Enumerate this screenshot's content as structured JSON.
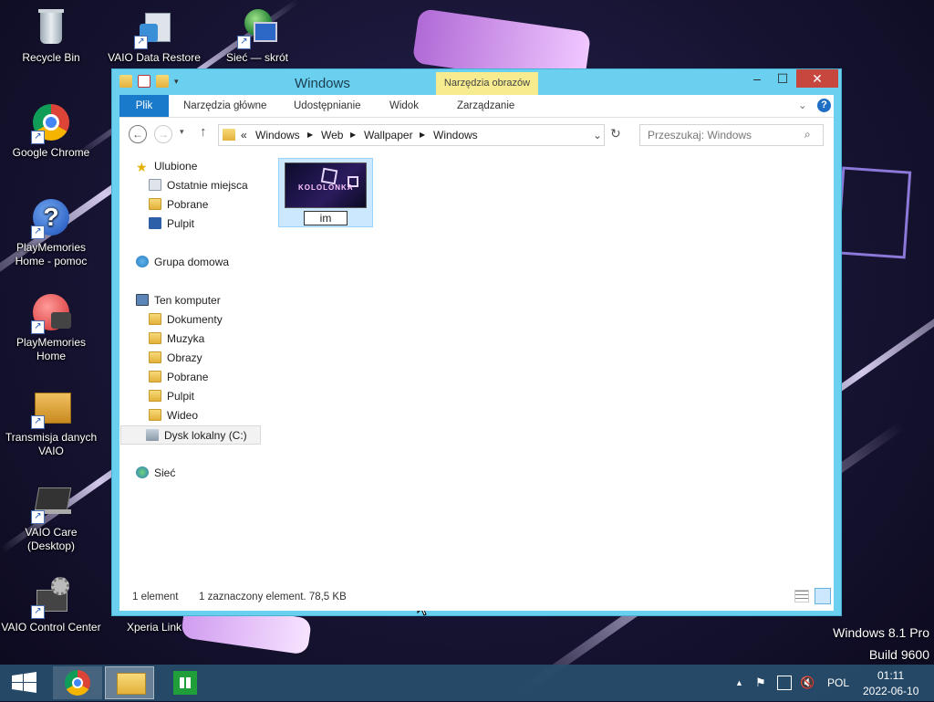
{
  "desktop": {
    "icons": [
      {
        "label": "Recycle Bin",
        "icon": "recycle-bin-icon"
      },
      {
        "label": "VAIO Data Restore",
        "icon": "vaio-data-restore-icon"
      },
      {
        "label": "Sieć — skrót",
        "icon": "network-shortcut-icon"
      },
      {
        "label": "Google Chrome",
        "icon": "chrome-icon"
      },
      {
        "label": "PlayMemories Home - pomoc",
        "icon": "help-icon"
      },
      {
        "label": "PlayMemories Home",
        "icon": "playmemories-icon"
      },
      {
        "label": "Transmisja danych VAIO",
        "icon": "vaio-transfer-icon"
      },
      {
        "label": "VAIO Care (Desktop)",
        "icon": "vaio-care-icon"
      },
      {
        "label": "VAIO Control Center",
        "icon": "vaio-control-center-icon"
      },
      {
        "label": "Xperia Link",
        "icon": "xperia-link-icon"
      }
    ],
    "watermark": {
      "line1": "Windows 8.1 Pro",
      "line2": "Build 9600"
    }
  },
  "window": {
    "title": "Windows",
    "context_tab": "Narzędzia obrazów",
    "ribbon_tabs": [
      "Plik",
      "Narzędzia główne",
      "Udostępnianie",
      "Widok",
      "Zarządzanie"
    ],
    "breadcrumb": [
      "«",
      "Windows",
      "Web",
      "Wallpaper",
      "Windows"
    ],
    "search_placeholder": "Przeszukaj: Windows",
    "nav": {
      "favorites": "Ulubione",
      "favorites_items": [
        "Ostatnie miejsca",
        "Pobrane",
        "Pulpit"
      ],
      "homegroup": "Grupa domowa",
      "computer": "Ten komputer",
      "computer_items": [
        "Dokumenty",
        "Muzyka",
        "Obrazy",
        "Pobrane",
        "Pulpit",
        "Wideo",
        "Dysk lokalny (C:)"
      ],
      "network": "Sieć"
    },
    "file": {
      "name": "im",
      "thumb_text": "KOLOLONKA"
    },
    "status": {
      "count": "1 element",
      "selection": "1 zaznaczony element. 78,5 KB"
    }
  },
  "taskbar": {
    "language": "POL",
    "time": "01:11",
    "date": "2022-06-10"
  }
}
